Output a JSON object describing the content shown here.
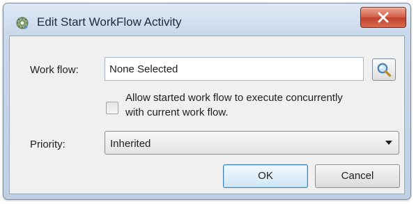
{
  "window": {
    "title": "Edit Start WorkFlow Activity",
    "icon": "workflow-gear-icon",
    "close_icon": "close-x-icon"
  },
  "form": {
    "workflow": {
      "label": "Work flow:",
      "value": "None Selected",
      "browse_icon": "magnifier-search-icon"
    },
    "concurrent": {
      "label": "Allow started work flow to execute concurrently with current work flow.",
      "checked": false
    },
    "priority": {
      "label": "Priority:",
      "selected": "Inherited"
    }
  },
  "buttons": {
    "ok": "OK",
    "cancel": "Cancel"
  },
  "colors": {
    "accent": "#3c7fb1",
    "close_button": "#c0402b",
    "titlebar": "#c9d8ea",
    "client_bg": "#f0f0f0"
  }
}
